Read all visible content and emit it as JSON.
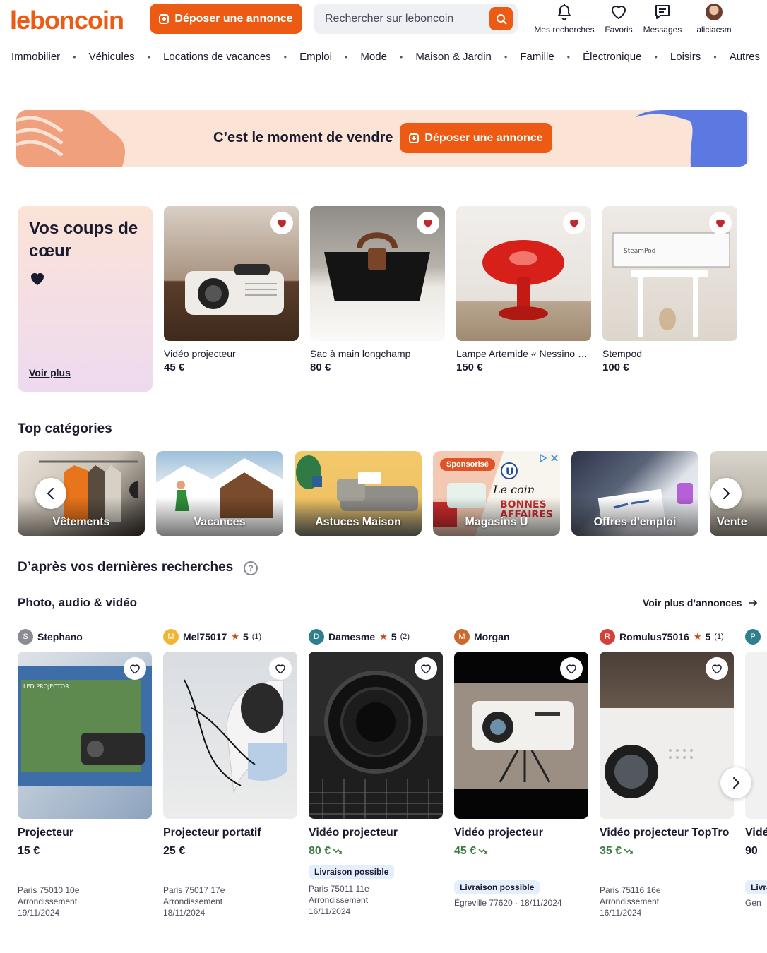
{
  "brand": {
    "logo": "leboncoin",
    "accent": "#ec5a13"
  },
  "header": {
    "post_ad": "Déposer une annonce",
    "search_placeholder": "Rechercher sur leboncoin",
    "nav": {
      "searches": "Mes recherches",
      "favorites": "Favoris",
      "messages": "Messages",
      "user": "aliciacsm"
    },
    "categories": [
      "Immobilier",
      "Véhicules",
      "Locations de vacances",
      "Emploi",
      "Mode",
      "Maison & Jardin",
      "Famille",
      "Électronique",
      "Loisirs",
      "Autres"
    ]
  },
  "banner": {
    "text": "C’est le moment de vendre",
    "button": "Déposer une annonce"
  },
  "favorites": {
    "title": "Vos coups de cœur",
    "more": "Voir plus",
    "items": [
      {
        "name": "Vidéo projecteur",
        "price": "45 €"
      },
      {
        "name": "Sac à main longchamp",
        "price": "80 €"
      },
      {
        "name": "Lampe Artemide « Nessino » rouge",
        "price": "150 €"
      },
      {
        "name": "Stempod",
        "price": "100 €"
      }
    ]
  },
  "top_categories": {
    "title": "Top catégories",
    "sponsored": "Sponsorisé",
    "items": [
      "Vêtements",
      "Vacances",
      "Astuces Maison",
      "Magasins U",
      "Offres d'emploi",
      "Vente"
    ]
  },
  "recent": {
    "title": "D’après vos dernières recherches",
    "help": "?",
    "subtitle": "Photo, audio & vidéo",
    "more": "Voir plus d’annonces",
    "listings": [
      {
        "initial": "S",
        "seller": "Stephano",
        "rating": "",
        "count": "",
        "title": "Projecteur",
        "price": "15 €",
        "badge": "",
        "location": "Paris 75010 10e",
        "location2": "Arrondissement",
        "date": "19/11/2024"
      },
      {
        "initial": "M",
        "seller": "Mel75017",
        "rating": "5",
        "count": "(1)",
        "title": "Projecteur portatif",
        "price": "25 €",
        "badge": "",
        "location": "Paris 75017 17e",
        "location2": "Arrondissement",
        "date": "18/11/2024"
      },
      {
        "initial": "D",
        "seller": "Damesme",
        "rating": "5",
        "count": "(2)",
        "title": "Vidéo projecteur",
        "price": "80 €",
        "badge": "Livraison possible",
        "location": "Paris 75011 11e",
        "location2": "Arrondissement",
        "date": "16/11/2024"
      },
      {
        "initial": "M",
        "seller": "Morgan",
        "rating": "",
        "count": "",
        "title": "Vidéo projecteur",
        "price": "45 €",
        "badge": "Livraison possible",
        "location": "Égreville 77620 · 18/11/2024",
        "location2": "",
        "date": ""
      },
      {
        "initial": "R",
        "seller": "Romulus75016",
        "rating": "5",
        "count": "(1)",
        "title": "Vidéo projecteur TopTro",
        "price": "35 €",
        "badge": "",
        "location": "Paris 75116 16e",
        "location2": "Arrondissement",
        "date": "16/11/2024"
      },
      {
        "initial": "P",
        "seller": "",
        "rating": "",
        "count": "",
        "title": "Vidéo",
        "price": "90",
        "badge": "Livraison possible",
        "location": "Gen",
        "location2": "",
        "date": ""
      }
    ]
  }
}
